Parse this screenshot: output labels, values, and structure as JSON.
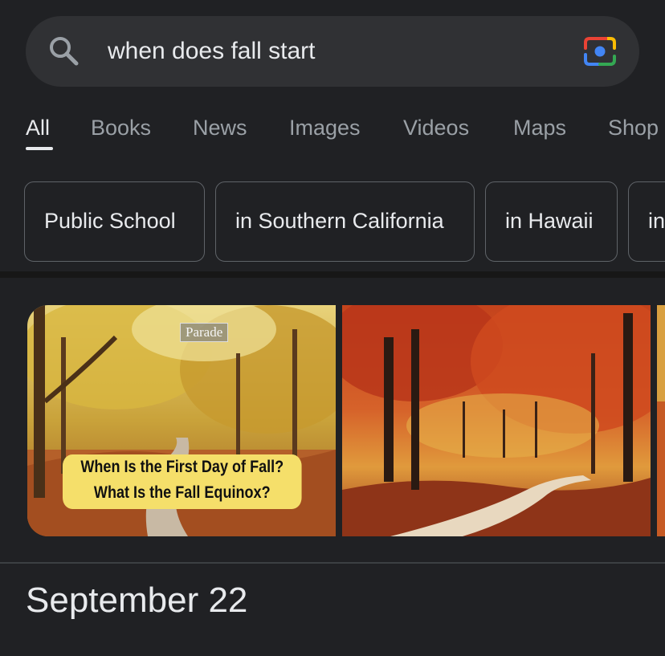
{
  "search": {
    "query": "when does fall start"
  },
  "tabs": [
    {
      "label": "All",
      "active": true
    },
    {
      "label": "Books"
    },
    {
      "label": "News"
    },
    {
      "label": "Images"
    },
    {
      "label": "Videos"
    },
    {
      "label": "Maps"
    },
    {
      "label": "Shop"
    }
  ],
  "chips": [
    {
      "label": "Public School"
    },
    {
      "label": "in Southern California"
    },
    {
      "label": "in Hawaii"
    },
    {
      "label": "in"
    }
  ],
  "images": [
    {
      "logo_text": "Parade",
      "caption_line1": "When Is the First Day of Fall?",
      "caption_line2": "What Is the Fall Equinox?"
    },
    {},
    {}
  ],
  "answer": {
    "text": "September 22"
  },
  "icons": {
    "search": "search-icon",
    "lens": "google-lens-icon"
  },
  "colors": {
    "background": "#202124",
    "searchbar": "#303134",
    "text": "#e8eaed",
    "muted_text": "#9aa0a6",
    "caption_bg": "#f5df6a"
  }
}
